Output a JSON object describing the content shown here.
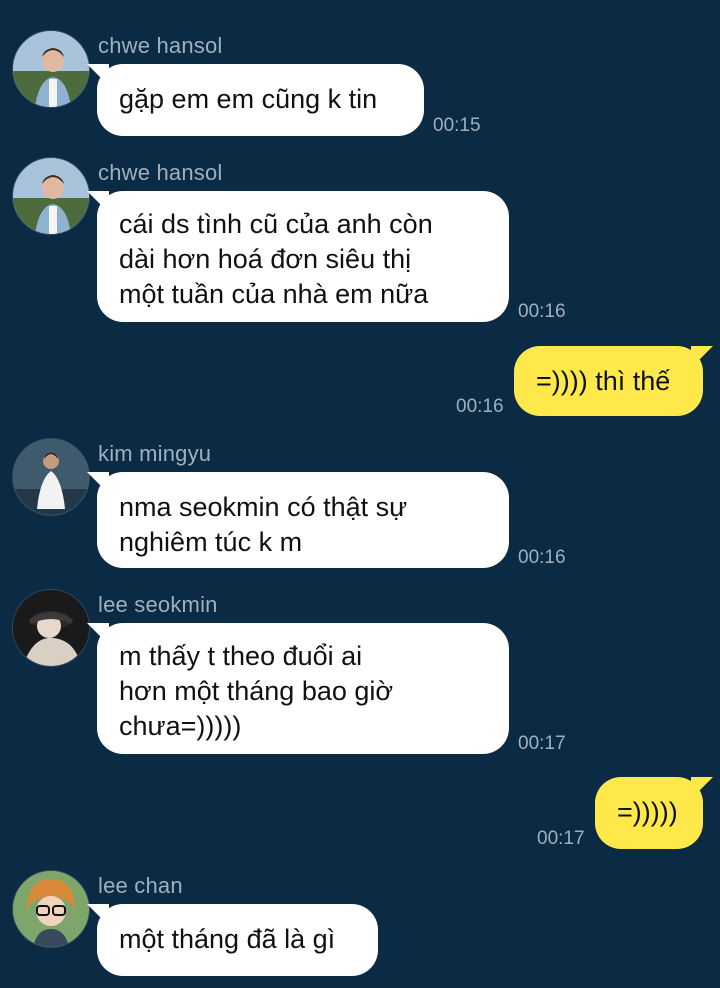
{
  "messages": [
    {
      "sender": "chwe hansol",
      "lines": [
        "gặp em em cũng k tin"
      ],
      "time": "00:15",
      "avatar": "avatar-photo-hansol"
    },
    {
      "sender": "chwe hansol",
      "lines": [
        "cái ds tình cũ của anh còn",
        "dài hơn hoá đơn siêu thị",
        "một tuần của nhà em nữa"
      ],
      "time": "00:16",
      "avatar": "avatar-photo-hansol"
    },
    {
      "sender": "",
      "lines": [
        "=)))) thì thế"
      ],
      "time": "00:16",
      "outgoing": true
    },
    {
      "sender": "kim mingyu",
      "lines": [
        "nma seokmin có thật sự",
        "nghiêm túc k m"
      ],
      "time": "00:16",
      "avatar": "avatar-photo-mingyu"
    },
    {
      "sender": "lee seokmin",
      "lines": [
        "m thấy t theo đuổi ai",
        "hơn một tháng bao giờ",
        "chưa=)))))"
      ],
      "time": "00:17",
      "avatar": "avatar-photo-seokmin"
    },
    {
      "sender": "",
      "lines": [
        "=)))))"
      ],
      "time": "00:17",
      "outgoing": true
    },
    {
      "sender": "lee chan",
      "lines": [
        "một tháng đã là gì"
      ],
      "time": "",
      "avatar": "avatar-photo-chan"
    }
  ],
  "colors": {
    "background": "#0b2a43",
    "incoming_bubble": "#ffffff",
    "outgoing_bubble": "#ffe94a",
    "meta_text": "#9fb0be"
  }
}
